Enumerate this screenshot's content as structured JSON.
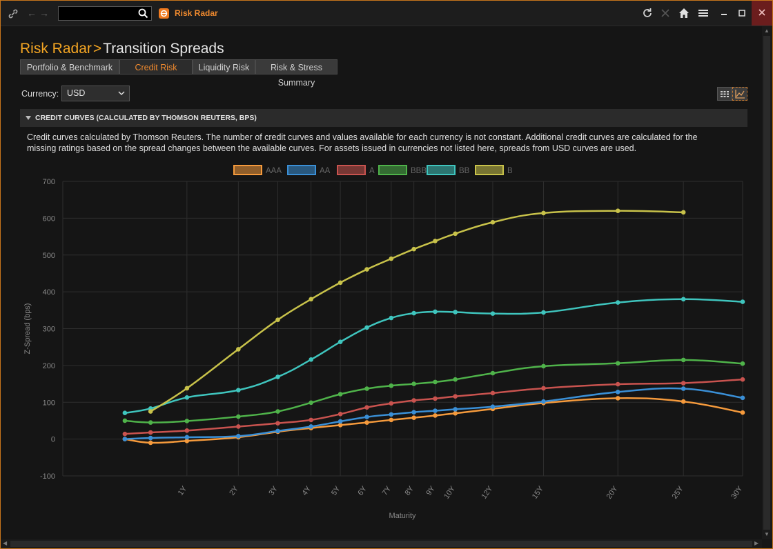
{
  "window": {
    "search": {
      "value": "",
      "placeholder": ""
    },
    "app_title": "Risk Radar",
    "icons": [
      "link-icon",
      "back-icon",
      "forward-icon",
      "search-icon",
      "refresh-icon",
      "close-x-icon",
      "home-icon",
      "menu-icon",
      "minimize-icon",
      "maximize-icon",
      "close-icon"
    ]
  },
  "breadcrumb": {
    "app": "Risk Radar",
    "sep": ">",
    "page": "Transition Spreads"
  },
  "tabs": [
    {
      "label": "Portfolio & Benchmark",
      "active": false
    },
    {
      "label": "Credit Risk",
      "active": true
    },
    {
      "label": "Liquidity Risk",
      "active": false
    },
    {
      "label": "Risk & Stress Summary",
      "active": false
    }
  ],
  "currency": {
    "label": "Currency:",
    "value": "USD"
  },
  "section": {
    "title": "CREDIT CURVES (CALCULATED BY THOMSON REUTERS, BPS)",
    "description_line1": "Credit curves calculated by Thomson Reuters. The number of credit curves and values available for each currency is not constant. Additional credit curves are calculated for the",
    "description_line2": "missing ratings based on the spread changes between the available curves. For assets issued in currencies not listed here, spreads from USD curves are used."
  },
  "colors": {
    "accent": "#f08a2e",
    "bg": "#151515"
  },
  "chart_data": {
    "type": "line",
    "xlabel": "Maturity",
    "ylabel": "Z-Spread (bps)",
    "ylim": [
      -100,
      700
    ],
    "yticks": [
      -100,
      0,
      100,
      200,
      300,
      400,
      500,
      600,
      700
    ],
    "xlim": [
      0,
      30
    ],
    "xticks": [
      {
        "v": 1,
        "label": "1Y"
      },
      {
        "v": 2,
        "label": "2Y"
      },
      {
        "v": 3,
        "label": "3Y"
      },
      {
        "v": 4,
        "label": "4Y"
      },
      {
        "v": 5,
        "label": "5Y"
      },
      {
        "v": 6,
        "label": "6Y"
      },
      {
        "v": 7,
        "label": "7Y"
      },
      {
        "v": 8,
        "label": "8Y"
      },
      {
        "v": 9,
        "label": "9Y"
      },
      {
        "v": 10,
        "label": "10Y"
      },
      {
        "v": 12,
        "label": "12Y"
      },
      {
        "v": 15,
        "label": "15Y"
      },
      {
        "v": 20,
        "label": "20Y"
      },
      {
        "v": 25,
        "label": "25Y"
      },
      {
        "v": 30,
        "label": "30Y"
      }
    ],
    "grid": true,
    "legend": "top-center",
    "series": [
      {
        "name": "AAA",
        "color": "#f59a3c",
        "points": [
          [
            0.25,
            0
          ],
          [
            0.5,
            -10
          ],
          [
            1,
            -5
          ],
          [
            2,
            5
          ],
          [
            3,
            20
          ],
          [
            4,
            30
          ],
          [
            5,
            38
          ],
          [
            6,
            45
          ],
          [
            7,
            52
          ],
          [
            8,
            58
          ],
          [
            9,
            64
          ],
          [
            10,
            70
          ],
          [
            12,
            82
          ],
          [
            15,
            98
          ],
          [
            20,
            111
          ],
          [
            25,
            102
          ],
          [
            30,
            72
          ]
        ]
      },
      {
        "name": "AA",
        "color": "#3a8fd6",
        "points": [
          [
            0.25,
            0
          ],
          [
            0.5,
            3
          ],
          [
            1,
            5
          ],
          [
            2,
            8
          ],
          [
            3,
            22
          ],
          [
            4,
            34
          ],
          [
            5,
            48
          ],
          [
            6,
            60
          ],
          [
            7,
            67
          ],
          [
            8,
            73
          ],
          [
            9,
            77
          ],
          [
            10,
            81
          ],
          [
            12,
            88
          ],
          [
            15,
            102
          ],
          [
            20,
            128
          ],
          [
            25,
            137
          ],
          [
            30,
            112
          ]
        ]
      },
      {
        "name": "A",
        "color": "#c9534f",
        "points": [
          [
            0.25,
            14
          ],
          [
            0.5,
            18
          ],
          [
            1,
            23
          ],
          [
            2,
            34
          ],
          [
            3,
            43
          ],
          [
            4,
            52
          ],
          [
            5,
            68
          ],
          [
            6,
            86
          ],
          [
            7,
            97
          ],
          [
            8,
            105
          ],
          [
            9,
            110
          ],
          [
            10,
            116
          ],
          [
            12,
            125
          ],
          [
            15,
            138
          ],
          [
            20,
            149
          ],
          [
            25,
            152
          ],
          [
            30,
            162
          ]
        ]
      },
      {
        "name": "BBB",
        "color": "#4fb34a",
        "points": [
          [
            0.25,
            50
          ],
          [
            0.5,
            45
          ],
          [
            1,
            49
          ],
          [
            2,
            61
          ],
          [
            3,
            75
          ],
          [
            4,
            99
          ],
          [
            5,
            122
          ],
          [
            6,
            137
          ],
          [
            7,
            145
          ],
          [
            8,
            150
          ],
          [
            9,
            155
          ],
          [
            10,
            162
          ],
          [
            12,
            179
          ],
          [
            15,
            198
          ],
          [
            20,
            206
          ],
          [
            25,
            215
          ],
          [
            30,
            205
          ]
        ]
      },
      {
        "name": "BB",
        "color": "#3fc5be",
        "points": [
          [
            0.25,
            71
          ],
          [
            0.5,
            83
          ],
          [
            1,
            113
          ],
          [
            2,
            133
          ],
          [
            3,
            169
          ],
          [
            4,
            216
          ],
          [
            5,
            264
          ],
          [
            6,
            303
          ],
          [
            7,
            329
          ],
          [
            8,
            342
          ],
          [
            9,
            346
          ],
          [
            10,
            345
          ],
          [
            12,
            341
          ],
          [
            15,
            344
          ],
          [
            20,
            371
          ],
          [
            25,
            380
          ],
          [
            30,
            373
          ]
        ]
      },
      {
        "name": "B",
        "color": "#c8c24a",
        "points": [
          [
            0.5,
            75
          ],
          [
            1,
            138
          ],
          [
            2,
            244
          ],
          [
            3,
            324
          ],
          [
            4,
            380
          ],
          [
            5,
            425
          ],
          [
            6,
            461
          ],
          [
            7,
            490
          ],
          [
            8,
            516
          ],
          [
            9,
            538
          ],
          [
            10,
            558
          ],
          [
            12,
            589
          ],
          [
            15,
            614
          ],
          [
            20,
            620
          ],
          [
            25,
            616
          ]
        ]
      }
    ]
  }
}
